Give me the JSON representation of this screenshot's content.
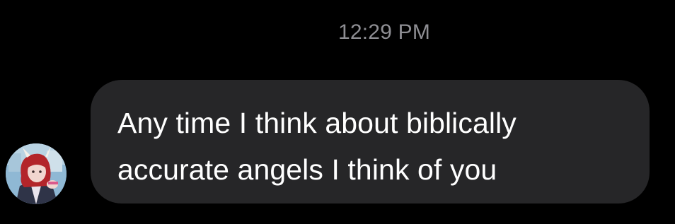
{
  "thread": {
    "timestamp": "12:29 PM"
  },
  "message": {
    "text": "Any time I think about biblically accurate angels I think of you",
    "bubble_color": "#262628",
    "text_color": "#ffffff"
  },
  "avatar": {
    "icon": "avatar-illustration"
  }
}
